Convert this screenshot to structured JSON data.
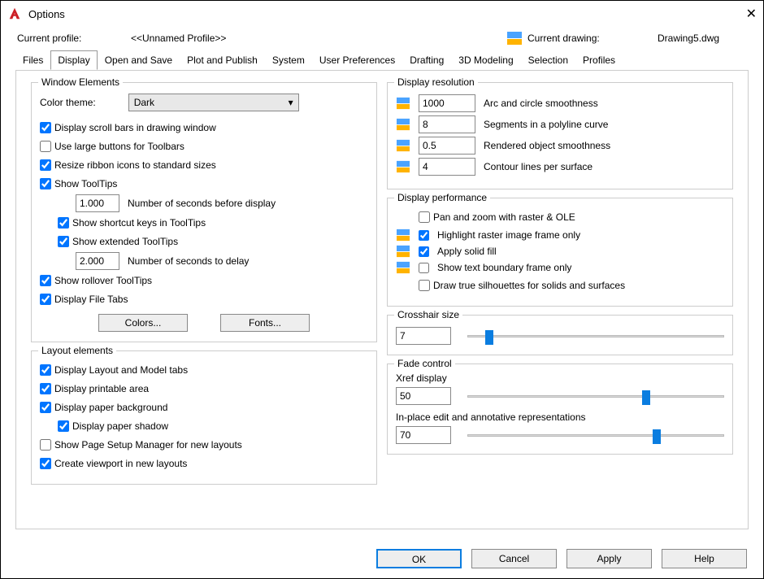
{
  "window": {
    "title": "Options"
  },
  "profile": {
    "currentProfileLabel": "Current profile:",
    "currentProfileValue": "<<Unnamed Profile>>",
    "currentDrawingLabel": "Current drawing:",
    "currentDrawingValue": "Drawing5.dwg"
  },
  "tabs": [
    "Files",
    "Display",
    "Open and Save",
    "Plot and Publish",
    "System",
    "User Preferences",
    "Drafting",
    "3D Modeling",
    "Selection",
    "Profiles"
  ],
  "activeTab": "Display",
  "windowElements": {
    "title": "Window Elements",
    "colorThemeLabel": "Color theme:",
    "colorThemeValue": "Dark",
    "scrollBars": {
      "label": "Display scroll bars in drawing window",
      "checked": true
    },
    "largeButtons": {
      "label": "Use large buttons for Toolbars",
      "checked": false
    },
    "resizeRibbon": {
      "label": "Resize ribbon icons to standard sizes",
      "checked": true
    },
    "showTooltips": {
      "label": "Show ToolTips",
      "checked": true
    },
    "ttSeconds": {
      "value": "1.000",
      "label": "Number of seconds before display"
    },
    "shortcutKeys": {
      "label": "Show shortcut keys in ToolTips",
      "checked": true
    },
    "extended": {
      "label": "Show extended ToolTips",
      "checked": true
    },
    "ttDelay": {
      "value": "2.000",
      "label": "Number of seconds to delay"
    },
    "rollover": {
      "label": "Show rollover ToolTips",
      "checked": true
    },
    "fileTabs": {
      "label": "Display File Tabs",
      "checked": true
    },
    "colorsBtn": "Colors...",
    "fontsBtn": "Fonts..."
  },
  "layoutElements": {
    "title": "Layout elements",
    "tabs": {
      "label": "Display Layout and Model tabs",
      "checked": true
    },
    "printable": {
      "label": "Display printable area",
      "checked": true
    },
    "paperBg": {
      "label": "Display paper background",
      "checked": true
    },
    "paperShadow": {
      "label": "Display paper shadow",
      "checked": true
    },
    "pageSetup": {
      "label": "Show Page Setup Manager for new layouts",
      "checked": false
    },
    "viewport": {
      "label": "Create viewport in new layouts",
      "checked": true
    }
  },
  "displayRes": {
    "title": "Display resolution",
    "arc": {
      "value": "1000",
      "label": "Arc and circle smoothness"
    },
    "seg": {
      "value": "8",
      "label": "Segments in a polyline curve"
    },
    "rend": {
      "value": "0.5",
      "label": "Rendered object smoothness"
    },
    "contour": {
      "value": "4",
      "label": "Contour lines per surface"
    }
  },
  "displayPerf": {
    "title": "Display performance",
    "pan": {
      "label": "Pan and zoom with raster & OLE",
      "checked": false
    },
    "highlight": {
      "label": "Highlight raster image frame only",
      "checked": true
    },
    "solid": {
      "label": "Apply solid fill",
      "checked": true
    },
    "textBound": {
      "label": "Show text boundary frame only",
      "checked": false
    },
    "silh": {
      "label": "Draw true silhouettes for solids and surfaces",
      "checked": false
    }
  },
  "crosshair": {
    "title": "Crosshair size",
    "value": "7",
    "percent": 7
  },
  "fade": {
    "title": "Fade control",
    "xrefLabel": "Xref display",
    "xrefValue": "50",
    "xrefPercent": 68,
    "inplaceLabel": "In-place edit and annotative representations",
    "inplaceValue": "70",
    "inplacePercent": 72
  },
  "footer": {
    "ok": "OK",
    "cancel": "Cancel",
    "apply": "Apply",
    "help": "Help"
  }
}
